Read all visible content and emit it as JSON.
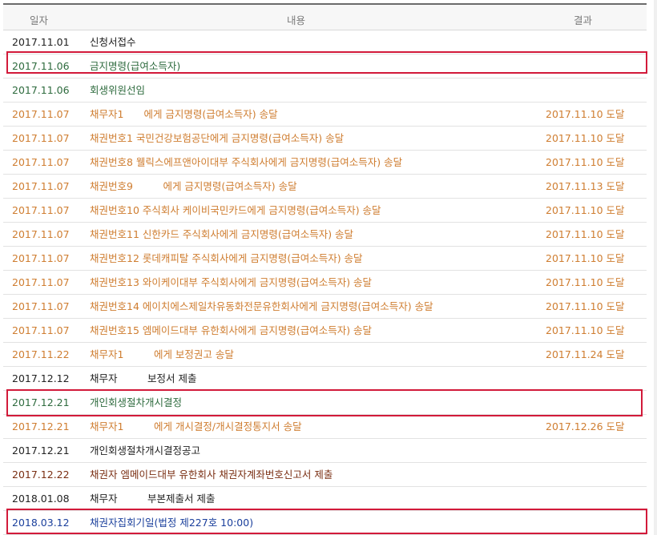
{
  "header": {
    "date": "일자",
    "content": "내용",
    "result": "결과"
  },
  "rows": [
    {
      "date": "2017.11.01",
      "content": "신청서접수",
      "result": "",
      "color": "black"
    },
    {
      "date": "2017.11.06",
      "content": "금지명령(급여소득자)",
      "result": "",
      "color": "green"
    },
    {
      "date": "2017.11.06",
      "content": "회생위원선임",
      "result": "",
      "color": "green"
    },
    {
      "date": "2017.11.07",
      "content": "채무자1　　에게 금지명령(급여소득자) 송달",
      "result": "2017.11.10 도달",
      "color": "orange"
    },
    {
      "date": "2017.11.07",
      "content": "채권번호1 국민건강보험공단에게 금지명령(급여소득자) 송달",
      "result": "2017.11.10 도달",
      "color": "orange"
    },
    {
      "date": "2017.11.07",
      "content": "채권번호8 웰릭스에프앤아이대부 주식회사에게 금지명령(급여소득자) 송달",
      "result": "2017.11.10 도달",
      "color": "orange"
    },
    {
      "date": "2017.11.07",
      "content": "채권번호9　　　에게 금지명령(급여소득자) 송달",
      "result": "2017.11.13 도달",
      "color": "orange"
    },
    {
      "date": "2017.11.07",
      "content": "채권번호10 주식회사 케이비국민카드에게 금지명령(급여소득자) 송달",
      "result": "2017.11.10 도달",
      "color": "orange"
    },
    {
      "date": "2017.11.07",
      "content": "채권번호11 신한카드 주식회사에게 금지명령(급여소득자) 송달",
      "result": "2017.11.10 도달",
      "color": "orange"
    },
    {
      "date": "2017.11.07",
      "content": "채권번호12 롯데캐피탈 주식회사에게 금지명령(급여소득자) 송달",
      "result": "2017.11.10 도달",
      "color": "orange"
    },
    {
      "date": "2017.11.07",
      "content": "채권번호13 와이케이대부 주식회사에게 금지명령(급여소득자) 송달",
      "result": "2017.11.10 도달",
      "color": "orange"
    },
    {
      "date": "2017.11.07",
      "content": "채권번호14 에이치에스제일차유동화전문유한회사에게 금지명령(급여소득자) 송달",
      "result": "2017.11.10 도달",
      "color": "orange"
    },
    {
      "date": "2017.11.07",
      "content": "채권번호15 엠메이드대부 유한회사에게 금지명령(급여소득자) 송달",
      "result": "2017.11.10 도달",
      "color": "orange"
    },
    {
      "date": "2017.11.22",
      "content": "채무자1　　　에게 보정권고 송달",
      "result": "2017.11.24 도달",
      "color": "orange"
    },
    {
      "date": "2017.12.12",
      "content": "채무자　　　보정서 제출",
      "result": "",
      "color": "black"
    },
    {
      "date": "2017.12.21",
      "content": "개인회생절차개시결정",
      "result": "",
      "color": "green"
    },
    {
      "date": "2017.12.21",
      "content": "채무자1　　　에게 개시결정/개시결정통지서 송달",
      "result": "2017.12.26 도달",
      "color": "orange"
    },
    {
      "date": "2017.12.21",
      "content": "개인회생절차개시결정공고",
      "result": "",
      "color": "black"
    },
    {
      "date": "2017.12.22",
      "content": "채권자 엠메이드대부 유한회사 채권자계좌번호신고서 제출",
      "result": "",
      "color": "brown"
    },
    {
      "date": "2018.01.08",
      "content": "채무자　　　부본제출서 제출",
      "result": "",
      "color": "black"
    },
    {
      "date": "2018.03.12",
      "content": "채권자집회기일(법정 제227호 10:00)",
      "result": "",
      "color": "blue"
    }
  ]
}
